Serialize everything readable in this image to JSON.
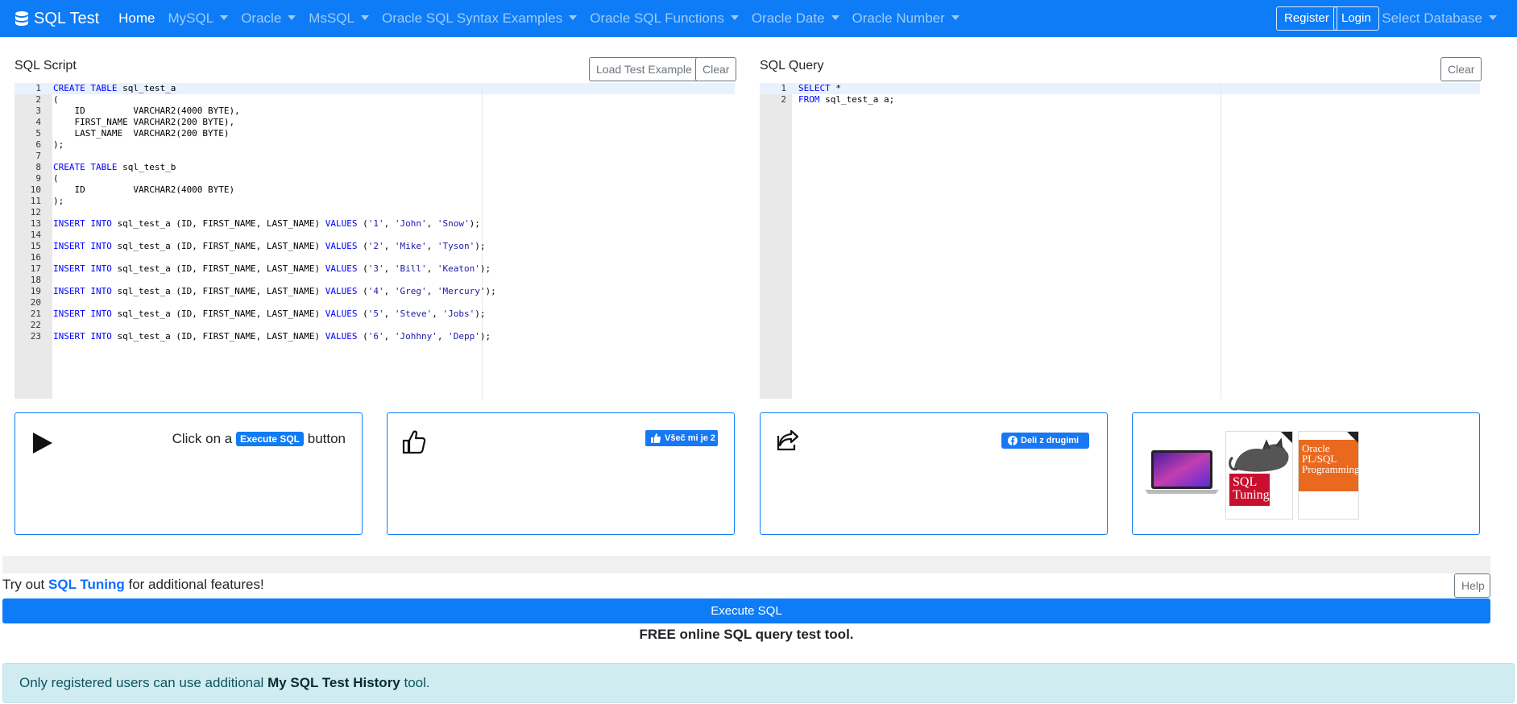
{
  "navbar": {
    "brand": "SQL Test",
    "items": [
      {
        "label": "Home",
        "dropdown": false
      },
      {
        "label": "MySQL",
        "dropdown": true
      },
      {
        "label": "Oracle",
        "dropdown": true
      },
      {
        "label": "MsSQL",
        "dropdown": true
      },
      {
        "label": "Oracle SQL Syntax Examples",
        "dropdown": true
      },
      {
        "label": "Oracle SQL Functions",
        "dropdown": true
      },
      {
        "label": "Oracle Date",
        "dropdown": true
      },
      {
        "label": "Oracle Number",
        "dropdown": true
      }
    ],
    "register": "Register",
    "login": "Login",
    "select_db": "Select Database"
  },
  "script_panel": {
    "title": "SQL Script",
    "load_button": "Load Test Example",
    "clear_button": "Clear",
    "lines": [
      "CREATE TABLE sql_test_a",
      "(",
      "    ID         VARCHAR2(4000 BYTE),",
      "    FIRST_NAME VARCHAR2(200 BYTE),",
      "    LAST_NAME  VARCHAR2(200 BYTE)",
      ");",
      "",
      "CREATE TABLE sql_test_b",
      "(",
      "    ID         VARCHAR2(4000 BYTE)",
      ");",
      "",
      "INSERT INTO sql_test_a (ID, FIRST_NAME, LAST_NAME) VALUES ('1', 'John', 'Snow');",
      "",
      "INSERT INTO sql_test_a (ID, FIRST_NAME, LAST_NAME) VALUES ('2', 'Mike', 'Tyson');",
      "",
      "INSERT INTO sql_test_a (ID, FIRST_NAME, LAST_NAME) VALUES ('3', 'Bill', 'Keaton');",
      "",
      "INSERT INTO sql_test_a (ID, FIRST_NAME, LAST_NAME) VALUES ('4', 'Greg', 'Mercury');",
      "",
      "INSERT INTO sql_test_a (ID, FIRST_NAME, LAST_NAME) VALUES ('5', 'Steve', 'Jobs');",
      "",
      "INSERT INTO sql_test_a (ID, FIRST_NAME, LAST_NAME) VALUES ('6', 'Johhny', 'Depp');"
    ]
  },
  "query_panel": {
    "title": "SQL Query",
    "clear_button": "Clear",
    "lines": [
      "SELECT *",
      "FROM sql_test_a a;"
    ]
  },
  "cards": {
    "execute": {
      "prefix": "Click on a",
      "pill": "Execute SQL",
      "suffix": "button"
    },
    "like": {
      "label": "Všeč mi je 2"
    },
    "share": {
      "label": "Deli z drugimi"
    },
    "books": {
      "book1_title": "SQL Tuning",
      "book2_title": "Oracle PL/SQL Programming"
    }
  },
  "bottom": {
    "tryout_prefix": "Try out",
    "tryout_link": "SQL Tuning",
    "tryout_suffix": "for additional features!",
    "help_button": "Help",
    "execute_button": "Execute SQL",
    "free_text": "FREE online SQL query test tool.",
    "alert_prefix": "Only registered users can use additional",
    "alert_bold": "My SQL Test History",
    "alert_suffix": "tool."
  },
  "colors": {
    "primary": "#0d7cf6",
    "keyword": "#0000ff",
    "string": "#1a1aa6"
  }
}
